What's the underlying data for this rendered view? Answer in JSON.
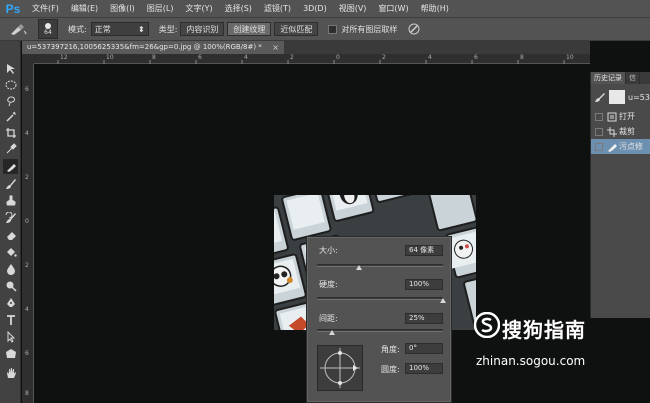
{
  "app": {
    "logo": "Ps"
  },
  "menu": [
    "文件(F)",
    "编辑(E)",
    "图像(I)",
    "图层(L)",
    "文字(Y)",
    "选择(S)",
    "滤镜(T)",
    "3D(D)",
    "视图(V)",
    "窗口(W)",
    "帮助(H)"
  ],
  "options": {
    "brush_size": "64",
    "mode_label": "模式:",
    "mode_value": "正常",
    "type_label": "类型:",
    "type_buttons": [
      "内容识别",
      "创建纹理",
      "近似匹配"
    ],
    "active_type_index": 1,
    "sample_all_label": "对所有图层取样"
  },
  "document": {
    "tab_title": "u=537397216,1005625335&fm=26&gp=0.jpg @ 100%(RGB/8#) *",
    "close": "×"
  },
  "rulers": {
    "h_ticks": [
      "12",
      "10",
      "8",
      "6",
      "4",
      "2",
      "0",
      "2",
      "4",
      "6",
      "8",
      "10"
    ],
    "v_ticks": [
      "6",
      "4",
      "2",
      "0",
      "2",
      "4",
      "6",
      "8"
    ]
  },
  "brush_popup": {
    "size_label": "大小:",
    "size_value": "64 像素",
    "size_fraction": 0.33,
    "hardness_label": "硬度:",
    "hardness_value": "100%",
    "hardness_fraction": 1.0,
    "spacing_label": "间距:",
    "spacing_value": "25%",
    "spacing_fraction": 0.12,
    "angle_label": "角度:",
    "angle_value": "0°",
    "roundness_label": "圆度:",
    "roundness_value": "100%"
  },
  "history_panel": {
    "tabs": [
      "历史记录",
      "信"
    ],
    "snapshot_label": "u=53",
    "items": [
      {
        "label": "打开",
        "icon": "document-icon",
        "selected": false
      },
      {
        "label": "裁剪",
        "icon": "crop-icon",
        "selected": false
      },
      {
        "label": "污点修",
        "icon": "healing-brush-icon",
        "selected": true
      }
    ]
  },
  "watermark": {
    "name": "搜狗指南",
    "url": "zhinan.sogou.com"
  },
  "colors": {
    "accent": "#31a8ff",
    "selection": "#6d8fb0",
    "ui_bg": "#535353"
  }
}
